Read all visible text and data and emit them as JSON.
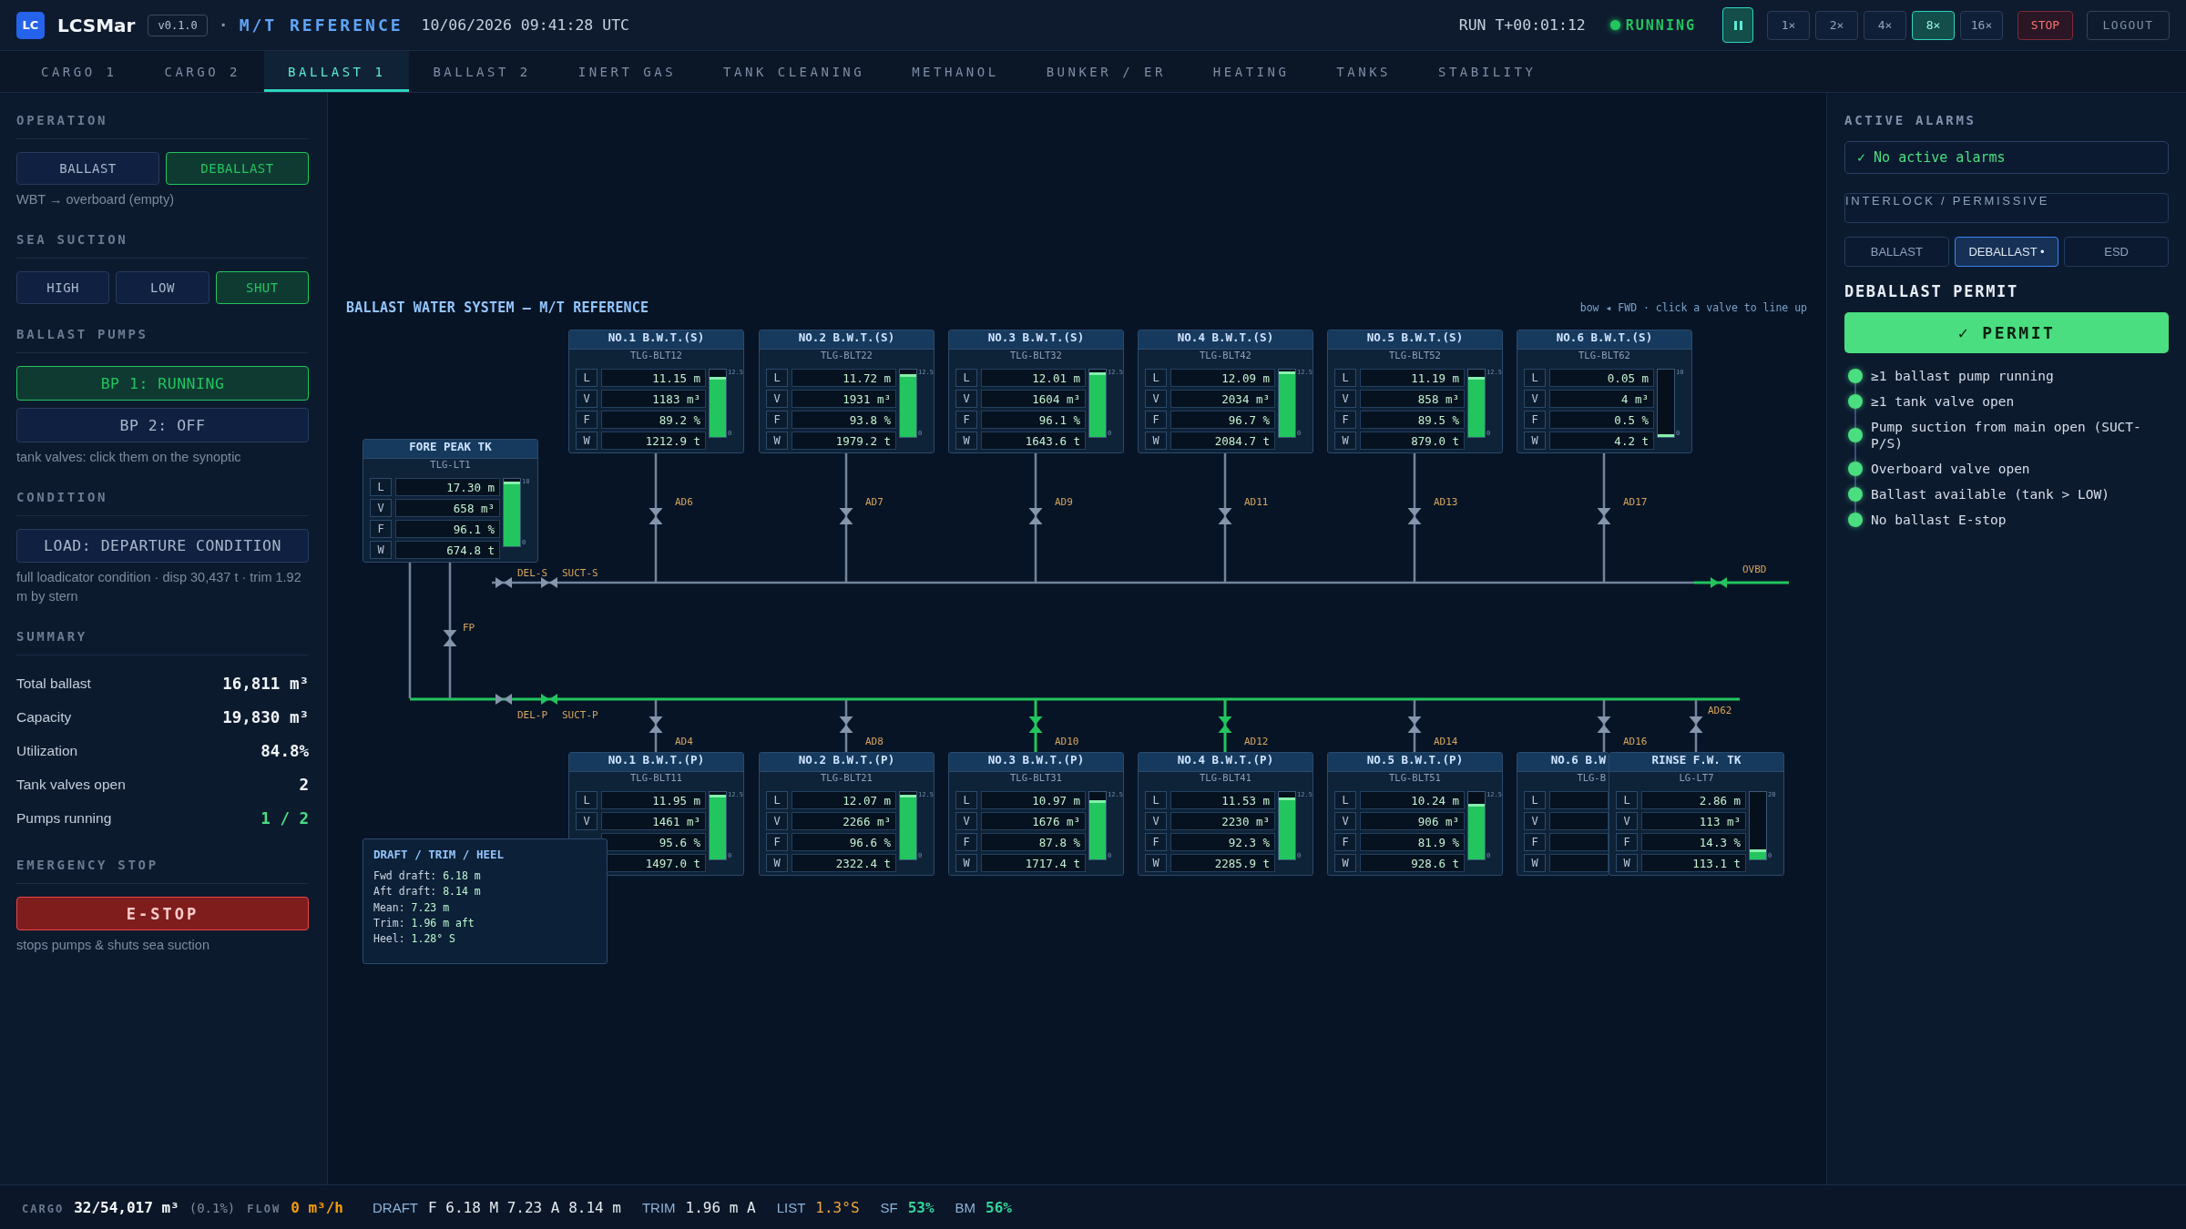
{
  "header": {
    "logo": "LC",
    "app_name": "LCSMar",
    "version": "v0.1.0",
    "separator": "·",
    "vessel": "M/T REFERENCE",
    "datetime": "10/06/2026 09:41:28 UTC",
    "run_time": "RUN T+00:01:12",
    "status": {
      "label": "RUNNING",
      "running": true
    },
    "speeds": [
      {
        "label": "1×",
        "selected": false
      },
      {
        "label": "2×",
        "selected": false
      },
      {
        "label": "4×",
        "selected": false
      },
      {
        "label": "8×",
        "selected": true
      },
      {
        "label": "16×",
        "selected": false
      }
    ],
    "stop_button": "STOP",
    "logout_button": "LOGOUT"
  },
  "tabs": [
    {
      "label": "CARGO 1",
      "selected": false
    },
    {
      "label": "CARGO 2",
      "selected": false
    },
    {
      "label": "BALLAST 1",
      "selected": true
    },
    {
      "label": "BALLAST 2",
      "selected": false
    },
    {
      "label": "INERT GAS",
      "selected": false
    },
    {
      "label": "TANK CLEANING",
      "selected": false
    },
    {
      "label": "METHANOL",
      "selected": false
    },
    {
      "label": "BUNKER / ER",
      "selected": false
    },
    {
      "label": "HEATING",
      "selected": false
    },
    {
      "label": "TANKS",
      "selected": false
    },
    {
      "label": "STABILITY",
      "selected": false
    }
  ],
  "sidebar": {
    "operation": {
      "title": "OPERATION",
      "options": [
        {
          "label": "BALLAST",
          "selected": false
        },
        {
          "label": "DEBALLAST",
          "selected": true
        }
      ],
      "note": "WBT → overboard (empty)"
    },
    "sea_suction": {
      "title": "SEA SUCTION",
      "options": [
        {
          "label": "HIGH",
          "selected": false
        },
        {
          "label": "LOW",
          "selected": false
        },
        {
          "label": "SHUT",
          "selected": true
        }
      ]
    },
    "ballast_pumps": {
      "title": "BALLAST PUMPS",
      "pumps": [
        {
          "label": "BP 1: RUNNING",
          "on": true
        },
        {
          "label": "BP 2: OFF",
          "on": false
        }
      ],
      "note": "tank valves: click them on the synoptic"
    },
    "condition": {
      "title": "CONDITION",
      "button": "LOAD: DEPARTURE CONDITION",
      "note": "full loadicator condition · disp 30,437 t · trim 1.92 m by stern"
    },
    "summary": {
      "title": "SUMMARY",
      "rows": [
        {
          "label": "Total ballast",
          "value": "16,811 m³",
          "highlight": false
        },
        {
          "label": "Capacity",
          "value": "19,830 m³",
          "highlight": false
        },
        {
          "label": "Utilization",
          "value": "84.8%",
          "highlight": false
        },
        {
          "label": "Tank valves open",
          "value": "2",
          "highlight": false
        },
        {
          "label": "Pumps running",
          "value": "1 / 2",
          "highlight": true
        }
      ]
    },
    "emergency_stop": {
      "title": "EMERGENCY STOP",
      "button": "E-STOP",
      "note": "stops pumps & shuts sea suction"
    }
  },
  "synoptic": {
    "title": "BALLAST WATER SYSTEM — M/T REFERENCE",
    "hint": "bow ◂ FWD · click a valve to line up",
    "fore_peak": {
      "name": "FORE PEAK TK",
      "tag": "TLG-LT1",
      "rows": [
        {
          "label": "L",
          "value": "17.30 m"
        },
        {
          "label": "V",
          "value": "658 m³"
        },
        {
          "label": "F",
          "value": "96.1 %"
        },
        {
          "label": "W",
          "value": "674.8 t"
        }
      ],
      "level": 0.961,
      "scale_max": "18",
      "scale_min": "0"
    },
    "starboard_tanks": [
      {
        "name": "NO.1 B.W.T.(S)",
        "tag": "TLG-BLT12",
        "rows": [
          {
            "label": "L",
            "value": "11.15 m"
          },
          {
            "label": "V",
            "value": "1183 m³"
          },
          {
            "label": "F",
            "value": "89.2 %"
          },
          {
            "label": "W",
            "value": "1212.9 t"
          }
        ],
        "level": 0.892,
        "scale_max": "12.5",
        "scale_min": "0",
        "valve": {
          "label": "AD6",
          "open": false
        }
      },
      {
        "name": "NO.2 B.W.T.(S)",
        "tag": "TLG-BLT22",
        "rows": [
          {
            "label": "L",
            "value": "11.72 m"
          },
          {
            "label": "V",
            "value": "1931 m³"
          },
          {
            "label": "F",
            "value": "93.8 %"
          },
          {
            "label": "W",
            "value": "1979.2 t"
          }
        ],
        "level": 0.938,
        "scale_max": "12.5",
        "scale_min": "0",
        "valve": {
          "label": "AD7",
          "open": false
        }
      },
      {
        "name": "NO.3 B.W.T.(S)",
        "tag": "TLG-BLT32",
        "rows": [
          {
            "label": "L",
            "value": "12.01 m"
          },
          {
            "label": "V",
            "value": "1604 m³"
          },
          {
            "label": "F",
            "value": "96.1 %"
          },
          {
            "label": "W",
            "value": "1643.6 t"
          }
        ],
        "level": 0.961,
        "scale_max": "12.5",
        "scale_min": "0",
        "valve": {
          "label": "AD9",
          "open": false
        }
      },
      {
        "name": "NO.4 B.W.T.(S)",
        "tag": "TLG-BLT42",
        "rows": [
          {
            "label": "L",
            "value": "12.09 m"
          },
          {
            "label": "V",
            "value": "2034 m³"
          },
          {
            "label": "F",
            "value": "96.7 %"
          },
          {
            "label": "W",
            "value": "2084.7 t"
          }
        ],
        "level": 0.967,
        "scale_max": "12.5",
        "scale_min": "0",
        "valve": {
          "label": "AD11",
          "open": false
        }
      },
      {
        "name": "NO.5 B.W.T.(S)",
        "tag": "TLG-BLT52",
        "rows": [
          {
            "label": "L",
            "value": "11.19 m"
          },
          {
            "label": "V",
            "value": "858 m³"
          },
          {
            "label": "F",
            "value": "89.5 %"
          },
          {
            "label": "W",
            "value": "879.0 t"
          }
        ],
        "level": 0.895,
        "scale_max": "12.5",
        "scale_min": "0",
        "valve": {
          "label": "AD13",
          "open": false
        }
      },
      {
        "name": "NO.6 B.W.T.(S)",
        "tag": "TLG-BLT62",
        "rows": [
          {
            "label": "L",
            "value": "0.05 m"
          },
          {
            "label": "V",
            "value": "4 m³"
          },
          {
            "label": "F",
            "value": "0.5 %"
          },
          {
            "label": "W",
            "value": "4.2 t"
          }
        ],
        "level": 0.005,
        "scale_max": "10",
        "scale_min": "0",
        "valve": {
          "label": "AD17",
          "open": false
        }
      }
    ],
    "port_tanks": [
      {
        "kind": "full",
        "name": "NO.1 B.W.T.(P)",
        "tag": "TLG-BLT11",
        "rows": [
          {
            "label": "L",
            "value": "11.95 m"
          },
          {
            "label": "V",
            "value": "1461 m³"
          },
          {
            "value": "95.6 %"
          },
          {
            "value": "1497.0 t"
          }
        ],
        "level": 0.956,
        "scale_max": "12.5",
        "scale_min": "0",
        "valve": {
          "label": "AD4",
          "open": false
        }
      },
      {
        "kind": "full",
        "name": "NO.2 B.W.T.(P)",
        "tag": "TLG-BLT21",
        "rows": [
          {
            "label": "L",
            "value": "12.07 m"
          },
          {
            "label": "V",
            "value": "2266 m³"
          },
          {
            "label": "F",
            "value": "96.6 %"
          },
          {
            "label": "W",
            "value": "2322.4 t"
          }
        ],
        "level": 0.966,
        "scale_max": "12.5",
        "scale_min": "0",
        "valve": {
          "label": "AD8",
          "open": false
        }
      },
      {
        "kind": "full",
        "name": "NO.3 B.W.T.(P)",
        "tag": "TLG-BLT31",
        "rows": [
          {
            "label": "L",
            "value": "10.97 m"
          },
          {
            "label": "V",
            "value": "1676 m³"
          },
          {
            "label": "F",
            "value": "87.8 %"
          },
          {
            "label": "W",
            "value": "1717.4 t"
          }
        ],
        "level": 0.878,
        "scale_max": "12.5",
        "scale_min": "0",
        "valve": {
          "label": "AD10",
          "open": true
        }
      },
      {
        "kind": "full",
        "name": "NO.4 B.W.T.(P)",
        "tag": "TLG-BLT41",
        "rows": [
          {
            "label": "L",
            "value": "11.53 m"
          },
          {
            "label": "V",
            "value": "2230 m³"
          },
          {
            "label": "F",
            "value": "92.3 %"
          },
          {
            "label": "W",
            "value": "2285.9 t"
          }
        ],
        "level": 0.923,
        "scale_max": "12.5",
        "scale_min": "0",
        "valve": {
          "label": "AD12",
          "open": true
        }
      },
      {
        "kind": "full",
        "name": "NO.5 B.W.T.(P)",
        "tag": "TLG-BLT51",
        "rows": [
          {
            "label": "L",
            "value": "10.24 m"
          },
          {
            "label": "V",
            "value": "906 m³"
          },
          {
            "label": "F",
            "value": "81.9 %"
          },
          {
            "label": "W",
            "value": "928.6 t"
          }
        ],
        "level": 0.819,
        "scale_max": "12.5",
        "scale_min": "0",
        "valve": {
          "label": "AD14",
          "open": false
        }
      },
      {
        "kind": "partial",
        "name": "NO.6 B.W",
        "tag": "TLG-B",
        "rows": [
          {
            "label": "L"
          },
          {
            "label": "V"
          },
          {
            "label": "F"
          },
          {
            "label": "W"
          }
        ],
        "valve": {
          "label": "AD16",
          "open": false
        }
      }
    ],
    "rinse_tank": {
      "name": "RINSE F.W. TK",
      "tag": "LG-LT7",
      "rows": [
        {
          "label": "L",
          "value": "2.86 m"
        },
        {
          "label": "V",
          "value": "113 m³"
        },
        {
          "label": "F",
          "value": "14.3 %"
        },
        {
          "label": "W",
          "value": "113.1 t"
        }
      ],
      "level": 0.143,
      "scale_max": "20",
      "scale_min": "0",
      "valve": {
        "label": "AD62",
        "open": false
      }
    },
    "manifold_valves": [
      {
        "label": "DEL-S",
        "open": false
      },
      {
        "label": "SUCT-S",
        "open": false
      },
      {
        "label": "DEL-P",
        "open": false
      },
      {
        "label": "SUCT-P",
        "open": true
      },
      {
        "label": "FP",
        "open": false
      },
      {
        "label": "OVBD",
        "open": true
      }
    ],
    "draft_panel": {
      "title": "DRAFT / TRIM / HEEL",
      "lines": [
        {
          "label": "Fwd draft:",
          "value": "6.18 m"
        },
        {
          "label": "Aft draft:",
          "value": "8.14 m"
        },
        {
          "label": "Mean:",
          "value": "7.23 m"
        },
        {
          "label": "Trim:",
          "value": "1.96 m aft"
        },
        {
          "label": "Heel:",
          "value": "1.28° S"
        }
      ]
    }
  },
  "right_panel": {
    "alarms_title": "ACTIVE ALARMS",
    "alarm_message": "✓ No active alarms",
    "interlock_title": "INTERLOCK / PERMISSIVE",
    "interlock_tabs": [
      {
        "label": "BALLAST",
        "selected": false
      },
      {
        "label": "DEBALLAST •",
        "selected": true
      },
      {
        "label": "ESD",
        "selected": false
      }
    ],
    "permit_title": "DEBALLAST PERMIT",
    "permit": {
      "label": "✓ PERMIT",
      "granted": true
    },
    "conditions": [
      {
        "label": "≥1 ballast pump running",
        "ok": true
      },
      {
        "label": "≥1 tank valve open",
        "ok": true
      },
      {
        "label": "Pump suction from main open (SUCT-P/S)",
        "ok": true
      },
      {
        "label": "Overboard valve open",
        "ok": true
      },
      {
        "label": "Ballast available (tank > LOW)",
        "ok": true
      },
      {
        "label": "No ballast E-stop",
        "ok": true
      }
    ]
  },
  "status_bar": [
    {
      "kind": "counter",
      "label": "CARGO",
      "value": "32/54,017 m³",
      "extra": "(0.1%)",
      "color": "#f8fafc",
      "emphasis": true
    },
    {
      "kind": "counter",
      "label": "FLOW",
      "value": "0 m³/h",
      "color": "#f59e0b",
      "emphasis": true
    },
    {
      "kind": "reading",
      "label": "DRAFT",
      "value": "F 6.18 M 7.23 A 8.14 m",
      "color": "#e5e9ef",
      "emphasis": false
    },
    {
      "kind": "reading",
      "label": "TRIM",
      "value": "1.96 m A",
      "color": "#e5e9ef",
      "emphasis": false
    },
    {
      "kind": "reading",
      "label": "LIST",
      "value": "1.3°S",
      "color": "#f0a93b",
      "emphasis": false
    },
    {
      "kind": "reading",
      "label": "SF",
      "value": "53%",
      "color": "#34d399",
      "emphasis": true
    },
    {
      "kind": "reading",
      "label": "BM",
      "value": "56%",
      "color": "#34d399",
      "emphasis": true
    }
  ]
}
